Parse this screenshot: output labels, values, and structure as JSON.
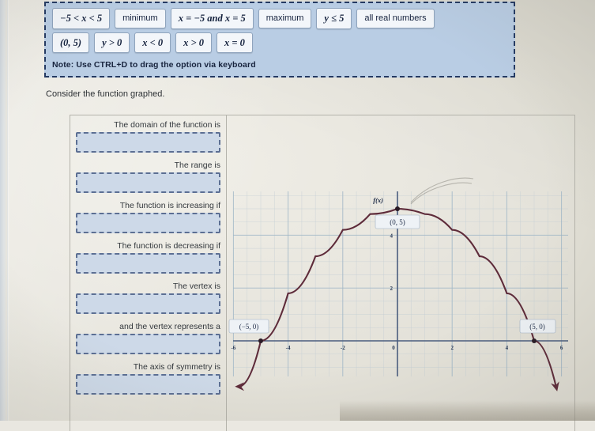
{
  "option_bank": {
    "note": "Note: Use CTRL+D to drag the option via keyboard",
    "row1": [
      {
        "label": "−5 < x < 5",
        "kind": "math"
      },
      {
        "label": "minimum",
        "kind": "word"
      },
      {
        "label": "x = −5 and x = 5",
        "kind": "math"
      },
      {
        "label": "maximum",
        "kind": "word"
      },
      {
        "label": "y ≤ 5",
        "kind": "math"
      },
      {
        "label": "all real numbers",
        "kind": "word"
      }
    ],
    "row2": [
      {
        "label": "(0, 5)",
        "kind": "math"
      },
      {
        "label": "y > 0",
        "kind": "math"
      },
      {
        "label": "x < 0",
        "kind": "math"
      },
      {
        "label": "x > 0",
        "kind": "math"
      },
      {
        "label": "x = 0",
        "kind": "math"
      }
    ]
  },
  "prompt": "Consider the function graphed.",
  "questions": [
    {
      "label": "The domain of the function is",
      "value": ""
    },
    {
      "label": "The range is",
      "value": ""
    },
    {
      "label": "The function is increasing if",
      "value": ""
    },
    {
      "label": "The function is decreasing if",
      "value": ""
    },
    {
      "label": "The vertex is",
      "value": ""
    },
    {
      "label": "and the vertex represents a",
      "value": ""
    },
    {
      "label": "The axis of symmetry is",
      "value": ""
    }
  ],
  "chart_data": {
    "type": "line",
    "title": "",
    "function_label": "f(x)",
    "xlabel": "",
    "ylabel": "",
    "xlim": [
      -6.6,
      6.6
    ],
    "ylim": [
      -1.8,
      6.6
    ],
    "x_ticks": [
      -6,
      -4,
      -2,
      0,
      2,
      4,
      6
    ],
    "x_tick_labels": [
      "-6",
      "-4",
      "-2",
      "0",
      "2",
      "4",
      "6"
    ],
    "y_ticks": [
      2,
      4
    ],
    "y_tick_labels": [
      "2",
      "4"
    ],
    "grid": true,
    "vertex": {
      "x": 0,
      "y": 5,
      "label": "(0, 5)"
    },
    "x_intercepts": [
      {
        "x": -5,
        "y": 0,
        "label": "(−5, 0)"
      },
      {
        "x": 5,
        "y": 0,
        "label": "(5, 0)"
      }
    ],
    "equation": "f(x) = -0.2 x^2 + 5",
    "x": [
      -5.8,
      -5,
      -4,
      -3,
      -2,
      -1,
      0,
      1,
      2,
      3,
      4,
      5,
      5.8
    ],
    "y": [
      -1.73,
      0,
      1.8,
      3.2,
      4.2,
      4.8,
      5,
      4.8,
      4.2,
      3.2,
      1.8,
      0,
      -1.73
    ],
    "series": [
      {
        "name": "f(x)",
        "color": "#5e2b3a",
        "values": [
          -1.73,
          0,
          1.8,
          3.2,
          4.2,
          4.8,
          5,
          4.8,
          4.2,
          3.2,
          1.8,
          0,
          -1.73
        ]
      }
    ]
  },
  "colors": {
    "bank_bg": "#b9cde4",
    "bank_border": "#243a63",
    "dropzone_fill": "#cdd9e8",
    "dropzone_border": "#5c6f93",
    "curve": "#5e2b3a",
    "axis": "#4a5d7e"
  }
}
